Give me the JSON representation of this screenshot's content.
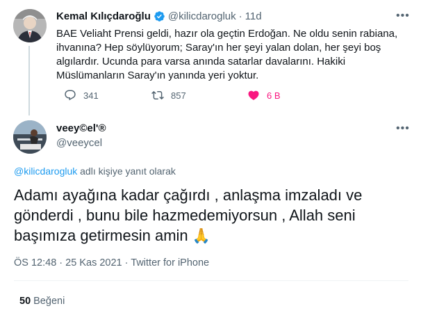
{
  "parent_tweet": {
    "author_name": "Kemal Kılıçdaroğlu",
    "handle": "@kilicdarogluk",
    "separator": "·",
    "time": "11d",
    "text": "BAE Veliaht Prensi geldi, hazır ola geçtin Erdoğan. Ne oldu senin rabiana,\nihvanına? Hep söylüyorum; Saray'ın her şeyi yalan dolan, her şeyi boş\nalgılardır. Ucunda para varsa anında satarlar davalarını. Hakiki\nMüslümanların Saray'ın yanında yeri yoktur.",
    "reply_count": "341",
    "retweet_count": "857",
    "like_count": "6 B",
    "icons": [
      "verified-badge-icon",
      "reply-icon",
      "retweet-icon",
      "like-heart-icon",
      "more-icon"
    ]
  },
  "reply_tweet": {
    "author_name": "veey©el'®",
    "handle": "@veeycel",
    "replying_mention": "@kilicdarogluk",
    "replying_suffix": " adlı kişiye yanıt olarak",
    "text": "Adamı ayağına kadar çağırdı   , anlaşma imzaladı ve gönderdi , bunu bile hazmedemiyorsun , Allah seni başımıza getirmesin amin ",
    "emoji": "🙏",
    "time": "ÖS 12:48",
    "dot": "·",
    "date": "25 Kas 2021",
    "source": "Twitter for iPhone",
    "likes_count": "50",
    "likes_label": "Beğeni"
  },
  "colors": {
    "text": "#0f1419",
    "secondary": "#536471",
    "accent": "#1d9bf0",
    "like": "#f91880",
    "divider": "#eff3f4"
  }
}
